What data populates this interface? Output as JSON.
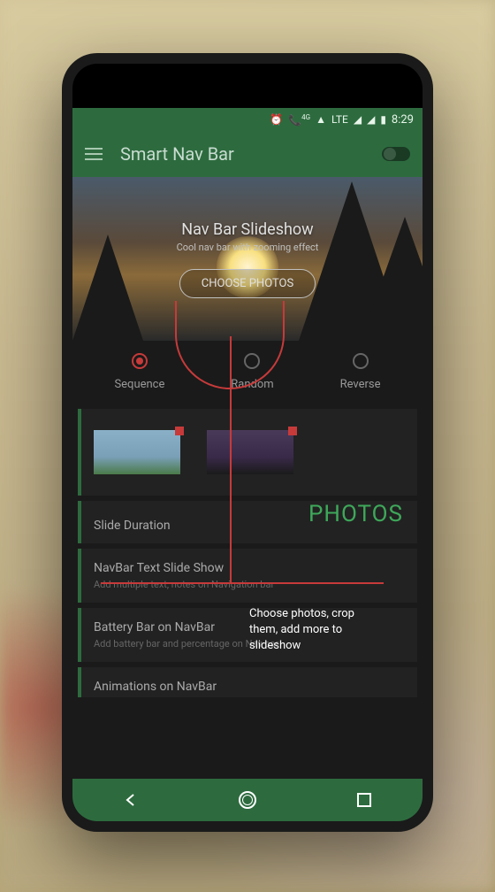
{
  "status": {
    "time": "8:29",
    "network": "LTE",
    "signal_4g": "4G"
  },
  "app": {
    "title": "Smart Nav Bar"
  },
  "hero": {
    "title": "Nav Bar Slideshow",
    "subtitle": "Cool nav bar with zooming effect",
    "button": "CHOOSE PHOTOS"
  },
  "radio": {
    "items": [
      "Sequence",
      "Random",
      "Reverse"
    ],
    "selected": 0
  },
  "slide_duration": {
    "label": "Slide Duration",
    "section_label": "PHOTOS"
  },
  "navbar_text": {
    "title": "NavBar Text Slide Show",
    "subtitle": "Add multiple text, notes on Navigation bar"
  },
  "battery_bar": {
    "title": "Battery Bar on NavBar",
    "subtitle": "Add battery bar and percentage on Nav bar"
  },
  "animations": {
    "title": "Animations on NavBar"
  },
  "callout": {
    "text": "Choose photos, crop them, add more to slideshow"
  }
}
